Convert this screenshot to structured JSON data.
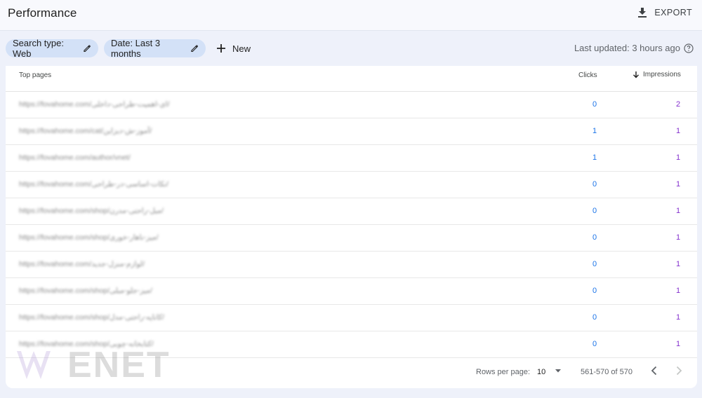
{
  "header": {
    "title": "Performance",
    "export_label": "EXPORT"
  },
  "filters": {
    "search_type": "Search type: Web",
    "date": "Date: Last 3 months",
    "new_label": "New",
    "last_updated": "Last updated: 3 hours ago"
  },
  "table": {
    "columns": {
      "pages": "Top pages",
      "clicks": "Clicks",
      "impressions": "Impressions"
    },
    "rows": [
      {
        "url": "https://fovahome.com/ای-اهمیت-طراحی-داخلی/",
        "clicks": "0",
        "impressions": "2"
      },
      {
        "url": "https://fovahome.com/cat/آموز-ش-دیزاین/",
        "clicks": "1",
        "impressions": "1"
      },
      {
        "url": "https://fovahome.com/author/vnet/",
        "clicks": "1",
        "impressions": "1"
      },
      {
        "url": "https://fovahome.com/نکات-اساسی-در-طراحی/",
        "clicks": "0",
        "impressions": "1"
      },
      {
        "url": "https://fovahome.com/shop/مبل-راحتی-مدرن/",
        "clicks": "0",
        "impressions": "1"
      },
      {
        "url": "https://fovahome.com/shop/میز-ناهار-خوری/",
        "clicks": "0",
        "impressions": "1"
      },
      {
        "url": "https://fovahome.com/لوازم-منزل-جدید/",
        "clicks": "0",
        "impressions": "1"
      },
      {
        "url": "https://fovahome.com/shop/میز-جلو-مبلی/",
        "clicks": "0",
        "impressions": "1"
      },
      {
        "url": "https://fovahome.com/shop/کاناپه-راحتی-مدل/",
        "clicks": "0",
        "impressions": "1"
      },
      {
        "url": "https://fovahome.com/shop/کتابخانه-چوبی/",
        "clicks": "0",
        "impressions": "1"
      }
    ]
  },
  "pagination": {
    "rows_per_page_label": "Rows per page:",
    "rows_per_page_value": "10",
    "range": "561-570 of 570"
  },
  "watermark": {
    "text": "ENET"
  },
  "colors": {
    "accent": "#1a73e8",
    "impressions": "#8430ce",
    "chip_bg": "#d3e1f7"
  }
}
